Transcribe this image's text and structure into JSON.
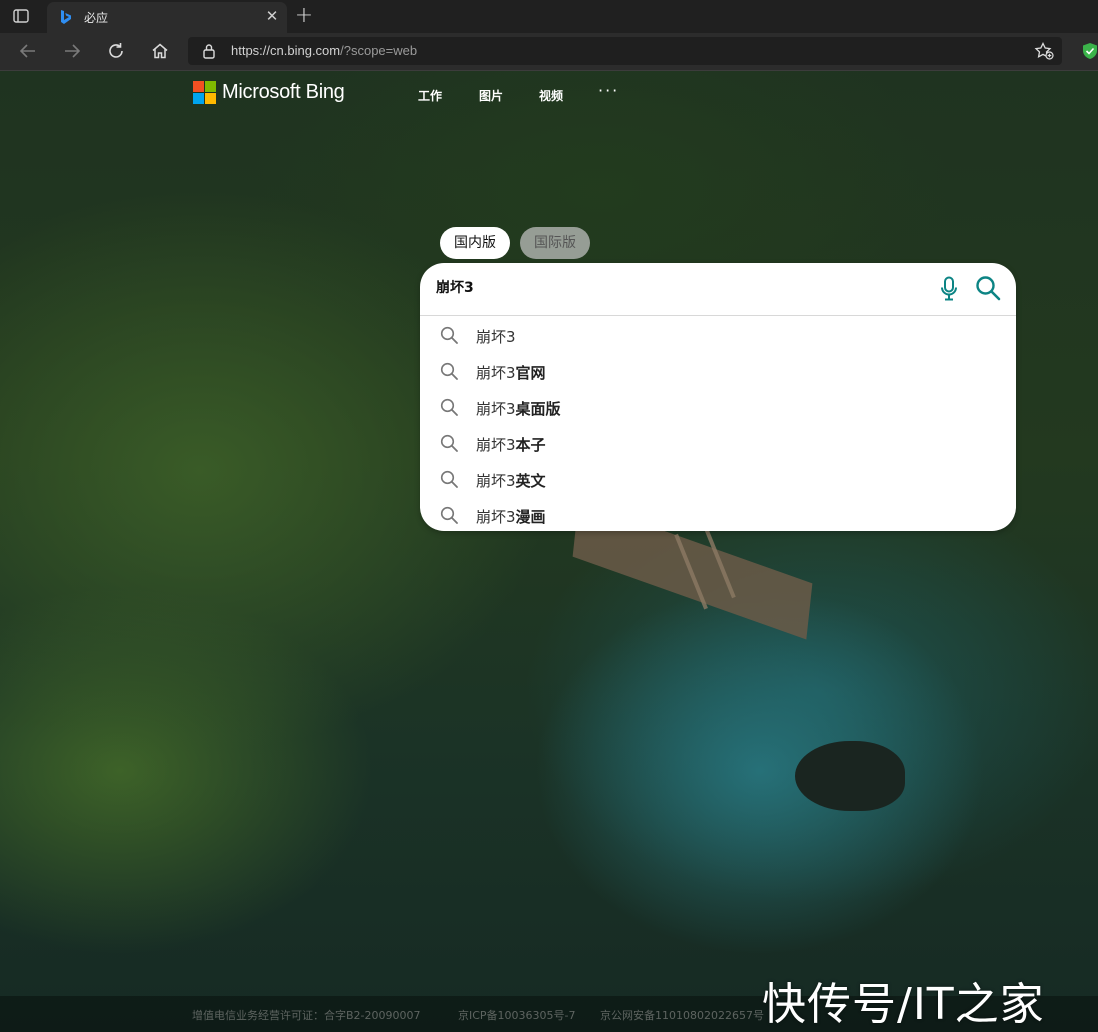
{
  "browser": {
    "tab": {
      "title": "必应"
    },
    "address": {
      "url_main": "https://cn.bing.com",
      "url_rest": "/?scope=web"
    }
  },
  "header": {
    "logo_text": "Microsoft Bing",
    "nav": [
      "工作",
      "图片",
      "视频"
    ],
    "more": "···"
  },
  "scope": {
    "domestic": "国内版",
    "international": "国际版"
  },
  "search": {
    "query": "崩坏3",
    "suggestions": [
      {
        "prefix": "崩坏3",
        "bold": ""
      },
      {
        "prefix": "崩坏3",
        "bold": "官网"
      },
      {
        "prefix": "崩坏3",
        "bold": "桌面版"
      },
      {
        "prefix": "崩坏3",
        "bold": "本子"
      },
      {
        "prefix": "崩坏3",
        "bold": "英文"
      },
      {
        "prefix": "崩坏3",
        "bold": "漫画"
      }
    ]
  },
  "footer": {
    "license": "增值电信业务经营许可证：合字B2-20090007",
    "icp": "京ICP备10036305号-7",
    "police": "京公网安备11010802022657号"
  },
  "watermark": "快传号/IT之家",
  "colors": {
    "accent": "#0c8484",
    "chrome_dark": "#202020"
  }
}
